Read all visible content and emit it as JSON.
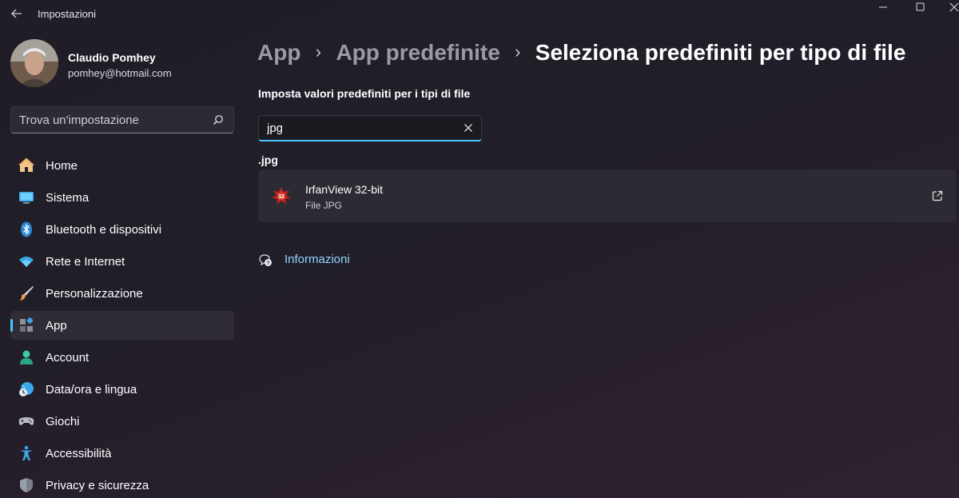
{
  "window": {
    "title": "Impostazioni"
  },
  "user": {
    "name": "Claudio Pomhey",
    "email": "pomhey@hotmail.com"
  },
  "search": {
    "placeholder": "Trova un'impostazione",
    "value": "",
    "icon": "search-icon"
  },
  "nav": {
    "items": [
      {
        "label": "Home",
        "icon": "home-icon"
      },
      {
        "label": "Sistema",
        "icon": "monitor-icon"
      },
      {
        "label": "Bluetooth e dispositivi",
        "icon": "bluetooth-icon"
      },
      {
        "label": "Rete e Internet",
        "icon": "wifi-icon"
      },
      {
        "label": "Personalizzazione",
        "icon": "brush-icon"
      },
      {
        "label": "App",
        "icon": "apps-icon",
        "selected": true
      },
      {
        "label": "Account",
        "icon": "person-icon"
      },
      {
        "label": "Data/ora e lingua",
        "icon": "globe-clock-icon"
      },
      {
        "label": "Giochi",
        "icon": "gamepad-icon"
      },
      {
        "label": "Accessibilità",
        "icon": "accessibility-icon"
      },
      {
        "label": "Privacy e sicurezza",
        "icon": "shield-icon"
      }
    ]
  },
  "breadcrumb": {
    "items": [
      "App",
      "App predefinite"
    ],
    "current": "Seleziona predefiniti per tipo di file",
    "separator": "›"
  },
  "main": {
    "section_title": "Imposta valori predefiniti per i tipi di file",
    "filter": {
      "value": "jpg"
    },
    "extension": ".jpg",
    "default_app": {
      "name": "IrfanView 32-bit",
      "file_type": "File JPG"
    },
    "info_link": "Informazioni"
  },
  "colors": {
    "accent": "#4cc2ff",
    "link": "#8fd6ff",
    "background": "#211f27",
    "card": "#2c2a33"
  }
}
